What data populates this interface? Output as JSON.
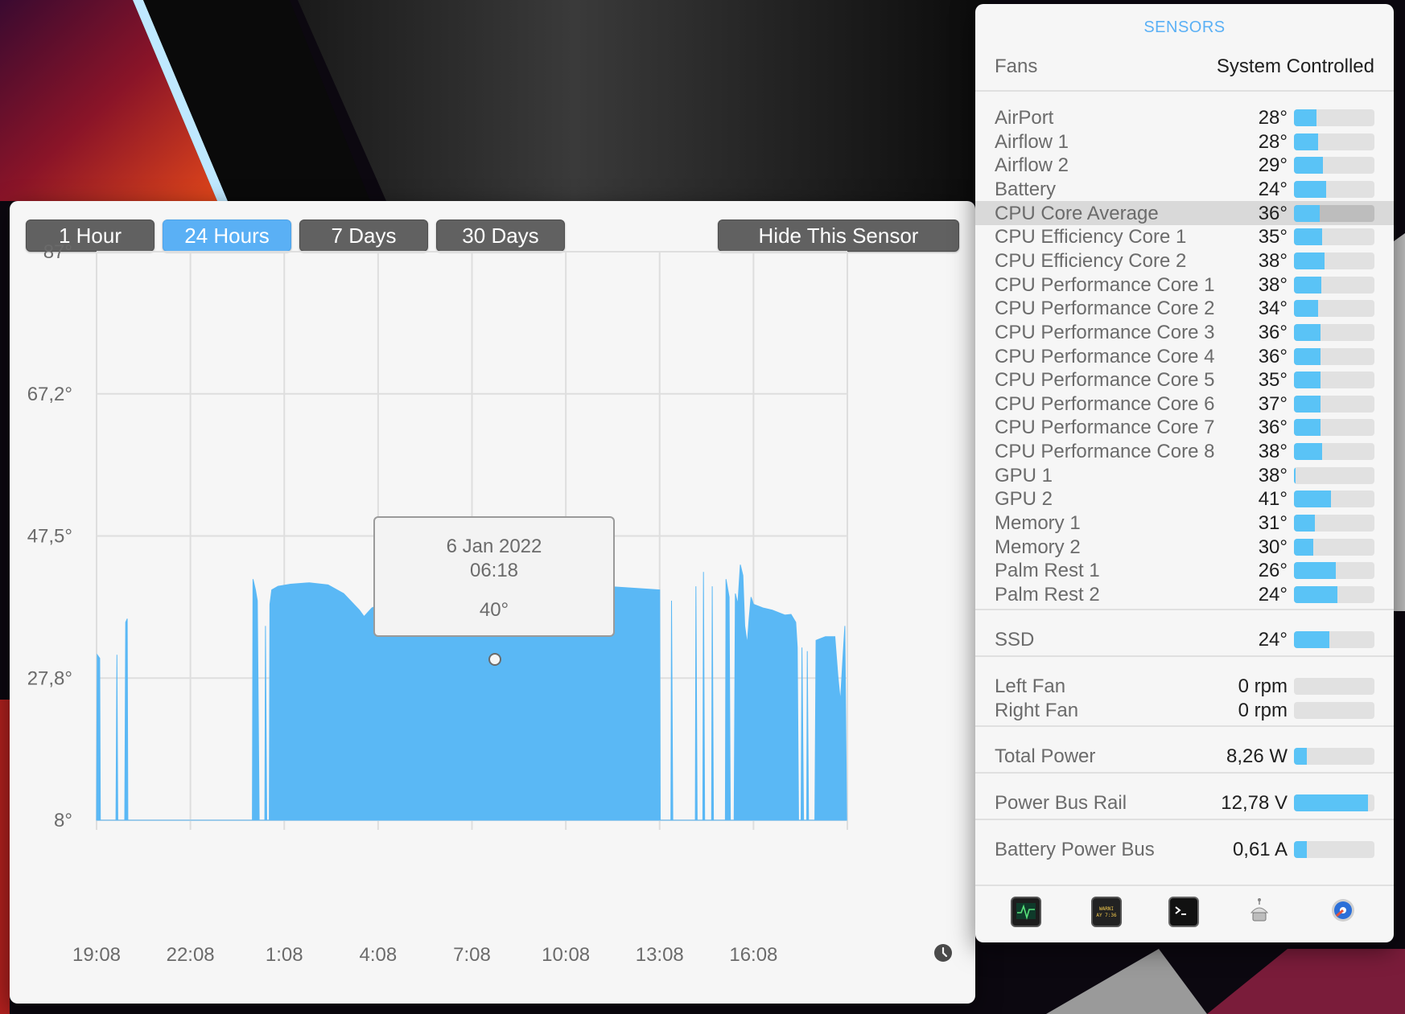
{
  "chart_window": {
    "range_buttons": [
      {
        "label": "1 Hour",
        "active": false
      },
      {
        "label": "24 Hours",
        "active": true
      },
      {
        "label": "7 Days",
        "active": false
      },
      {
        "label": "30 Days",
        "active": false
      }
    ],
    "hide_button_label": "Hide This Sensor",
    "tooltip": {
      "date": "6 Jan 2022",
      "time": "06:18",
      "value": "40°"
    }
  },
  "chart_data": {
    "type": "area",
    "y_tick_labels": [
      "87°",
      "67,2°",
      "47,5°",
      "27,8°",
      "8°"
    ],
    "ylim": [
      8,
      87
    ],
    "x_tick_labels": [
      "19:08",
      "22:08",
      "1:08",
      "4:08",
      "7:08",
      "10:08",
      "13:08",
      "16:08"
    ],
    "x_unit": "hours since 19:08",
    "grid": true,
    "color": "#5ab8f5",
    "points": [
      [
        0.0,
        8
      ],
      [
        0.02,
        31
      ],
      [
        0.1,
        30.5
      ],
      [
        0.12,
        8
      ],
      [
        0.62,
        8
      ],
      [
        0.65,
        31
      ],
      [
        0.68,
        8
      ],
      [
        0.9,
        8
      ],
      [
        0.93,
        35.5
      ],
      [
        0.98,
        36
      ],
      [
        1.0,
        8
      ],
      [
        4.98,
        8
      ],
      [
        5.0,
        41.5
      ],
      [
        5.08,
        40
      ],
      [
        5.14,
        38.5
      ],
      [
        5.2,
        8
      ],
      [
        5.38,
        8
      ],
      [
        5.4,
        35
      ],
      [
        5.44,
        8
      ],
      [
        5.52,
        8
      ],
      [
        5.54,
        38
      ],
      [
        5.6,
        40
      ],
      [
        5.8,
        40.5
      ],
      [
        6.2,
        40.8
      ],
      [
        6.8,
        41
      ],
      [
        7.4,
        40.7
      ],
      [
        7.9,
        39.5
      ],
      [
        8.4,
        37.2
      ],
      [
        8.55,
        36.3
      ],
      [
        8.8,
        37.5
      ],
      [
        9.3,
        38.5
      ],
      [
        9.9,
        39.0
      ],
      [
        10.6,
        39.2
      ],
      [
        11.2,
        39.3
      ],
      [
        12.0,
        39.4
      ],
      [
        12.8,
        39.6
      ],
      [
        13.6,
        39.9
      ],
      [
        14.4,
        40.2
      ],
      [
        15.2,
        40.5
      ],
      [
        16.0,
        40.6
      ],
      [
        16.6,
        40.4
      ],
      [
        18.0,
        40.0
      ],
      [
        18.02,
        8
      ],
      [
        18.36,
        8
      ],
      [
        18.38,
        38.5
      ],
      [
        18.42,
        8
      ],
      [
        19.14,
        8
      ],
      [
        19.16,
        40.5
      ],
      [
        19.2,
        8
      ],
      [
        19.38,
        8
      ],
      [
        19.4,
        42.5
      ],
      [
        19.44,
        8
      ],
      [
        19.66,
        8
      ],
      [
        19.68,
        40.5
      ],
      [
        19.72,
        8
      ],
      [
        20.1,
        8
      ],
      [
        20.12,
        41.5
      ],
      [
        20.22,
        39
      ],
      [
        20.26,
        8
      ],
      [
        20.38,
        8
      ],
      [
        20.42,
        39.5
      ],
      [
        20.5,
        38
      ],
      [
        20.58,
        43.5
      ],
      [
        20.66,
        42
      ],
      [
        20.72,
        35
      ],
      [
        20.8,
        32.5
      ],
      [
        20.86,
        36
      ],
      [
        20.92,
        39
      ],
      [
        21.0,
        38
      ],
      [
        21.3,
        37.5
      ],
      [
        21.6,
        37.2
      ],
      [
        22.0,
        36.5
      ],
      [
        22.2,
        36.6
      ],
      [
        22.35,
        35.5
      ],
      [
        22.4,
        32
      ],
      [
        22.44,
        8
      ],
      [
        22.52,
        8
      ],
      [
        22.55,
        32
      ],
      [
        22.6,
        8
      ],
      [
        22.7,
        8
      ],
      [
        22.72,
        31.5
      ],
      [
        22.76,
        8
      ],
      [
        22.96,
        8
      ],
      [
        23.0,
        33
      ],
      [
        23.3,
        33.5
      ],
      [
        23.6,
        33.5
      ],
      [
        23.7,
        28
      ],
      [
        23.78,
        24.5
      ],
      [
        23.85,
        30
      ],
      [
        23.92,
        35
      ],
      [
        23.98,
        8
      ]
    ]
  },
  "sensors": {
    "title": "SENSORS",
    "fans_label": "Fans",
    "fans_value": "System Controlled",
    "temps": [
      {
        "name": "AirPort",
        "value": "28°",
        "level": 0.28
      },
      {
        "name": "Airflow 1",
        "value": "28°",
        "level": 0.3
      },
      {
        "name": "Airflow 2",
        "value": "29°",
        "level": 0.36
      },
      {
        "name": "Battery",
        "value": "24°",
        "level": 0.4
      },
      {
        "name": "CPU Core Average",
        "value": "36°",
        "level": 0.32,
        "selected": true
      },
      {
        "name": "CPU Efficiency Core 1",
        "value": "35°",
        "level": 0.35
      },
      {
        "name": "CPU Efficiency Core 2",
        "value": "38°",
        "level": 0.38
      },
      {
        "name": "CPU Performance Core 1",
        "value": "38°",
        "level": 0.34
      },
      {
        "name": "CPU Performance Core 2",
        "value": "34°",
        "level": 0.3
      },
      {
        "name": "CPU Performance Core 3",
        "value": "36°",
        "level": 0.33
      },
      {
        "name": "CPU Performance Core 4",
        "value": "36°",
        "level": 0.33
      },
      {
        "name": "CPU Performance Core 5",
        "value": "35°",
        "level": 0.33
      },
      {
        "name": "CPU Performance Core 6",
        "value": "37°",
        "level": 0.33
      },
      {
        "name": "CPU Performance Core 7",
        "value": "36°",
        "level": 0.33
      },
      {
        "name": "CPU Performance Core 8",
        "value": "38°",
        "level": 0.35
      },
      {
        "name": "GPU 1",
        "value": "38°",
        "level": 0.02
      },
      {
        "name": "GPU 2",
        "value": "41°",
        "level": 0.46
      },
      {
        "name": "Memory 1",
        "value": "31°",
        "level": 0.26
      },
      {
        "name": "Memory 2",
        "value": "30°",
        "level": 0.24
      },
      {
        "name": "Palm Rest 1",
        "value": "26°",
        "level": 0.52
      },
      {
        "name": "Palm Rest 2",
        "value": "24°",
        "level": 0.54
      }
    ],
    "ssd": {
      "name": "SSD",
      "value": "24°",
      "level": 0.44
    },
    "fans": [
      {
        "name": "Left Fan",
        "value": "0 rpm",
        "level": 0
      },
      {
        "name": "Right Fan",
        "value": "0 rpm",
        "level": 0
      }
    ],
    "total_power": {
      "name": "Total Power",
      "value": "8,26 W",
      "level": 0.16
    },
    "power_bus_rail": {
      "name": "Power Bus Rail",
      "value": "12,78 V",
      "level": 0.92
    },
    "battery_power_bus": {
      "name": "Battery Power Bus",
      "value": "0,61 A",
      "level": 0.16
    },
    "toolbar_icons": [
      "activity-monitor-icon",
      "console-icon",
      "terminal-icon",
      "system-information-icon",
      "disk-utility-icon"
    ],
    "toolbar_icon_text": "WARNI\nAY 7:36"
  }
}
